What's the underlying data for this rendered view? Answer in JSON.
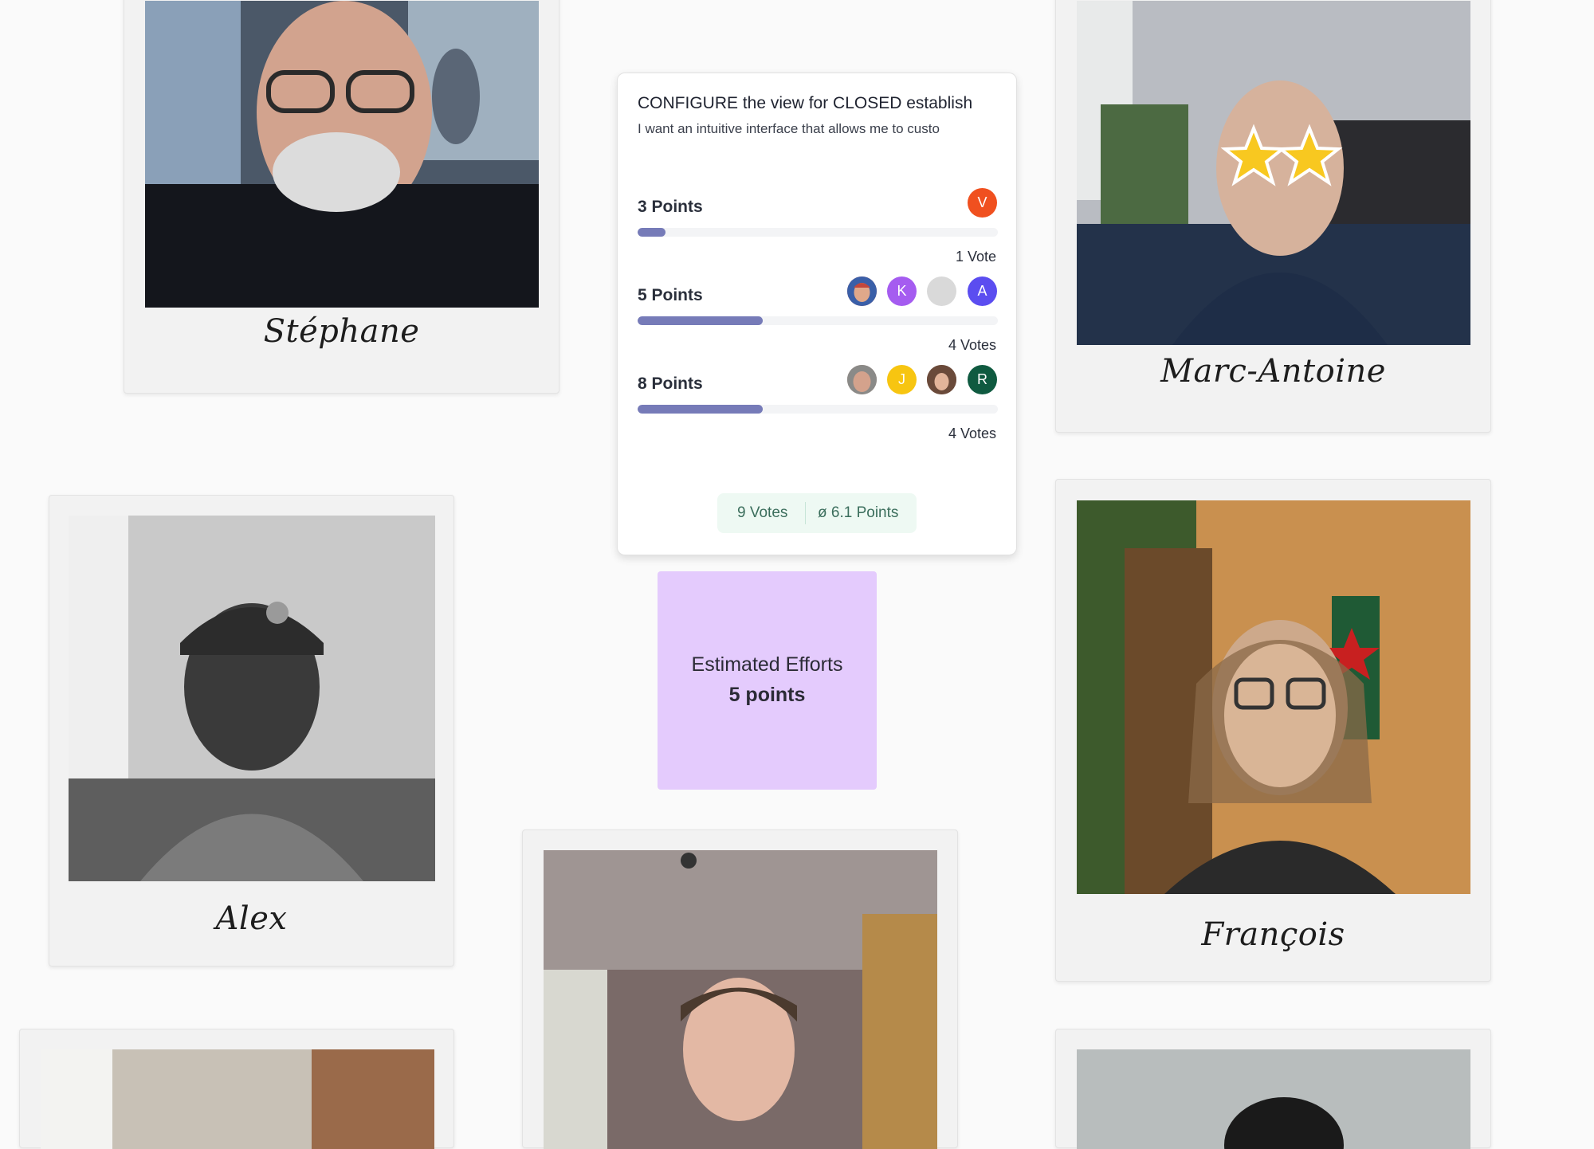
{
  "participants": {
    "stephane": {
      "name": "Stéphane"
    },
    "marc_antoine": {
      "name": "Marc-Antoine"
    },
    "alex": {
      "name": "Alex"
    },
    "francois": {
      "name": "François"
    }
  },
  "story": {
    "title": "CONFIGURE the view for CLOSED establish",
    "description": "I want an intuitive interface that allows me to custo"
  },
  "options": [
    {
      "label": "3 Points",
      "votes_label": "1 Vote",
      "vote_count": 1,
      "share": 0.1,
      "voters": [
        {
          "initial": "V",
          "color": "#f0501f"
        }
      ]
    },
    {
      "label": "5 Points",
      "votes_label": "4 Votes",
      "vote_count": 4,
      "share": 0.444,
      "voters": [
        {
          "initial": "",
          "color": "#c2473c",
          "type": "photo"
        },
        {
          "initial": "K",
          "color": "#a55cf0"
        },
        {
          "initial": "",
          "color": "#d9d9d9"
        },
        {
          "initial": "A",
          "color": "#5b4df0"
        }
      ]
    },
    {
      "label": "8 Points",
      "votes_label": "4 Votes",
      "vote_count": 4,
      "share": 0.444,
      "voters": [
        {
          "initial": "",
          "color": "#b08070",
          "type": "photo"
        },
        {
          "initial": "J",
          "color": "#f7c511"
        },
        {
          "initial": "",
          "color": "#9a6a55",
          "type": "photo"
        },
        {
          "initial": "R",
          "color": "#0f5a40"
        }
      ]
    }
  ],
  "summary": {
    "total_votes": "9 Votes",
    "average": "ø 6.1 Points"
  },
  "estimate_note": {
    "line1": "Estimated Efforts",
    "line2": "5 points"
  },
  "colors": {
    "bar_fill": "#767bb8",
    "note_bg": "#e4cbfd",
    "summary_bg": "#eef9f3"
  }
}
